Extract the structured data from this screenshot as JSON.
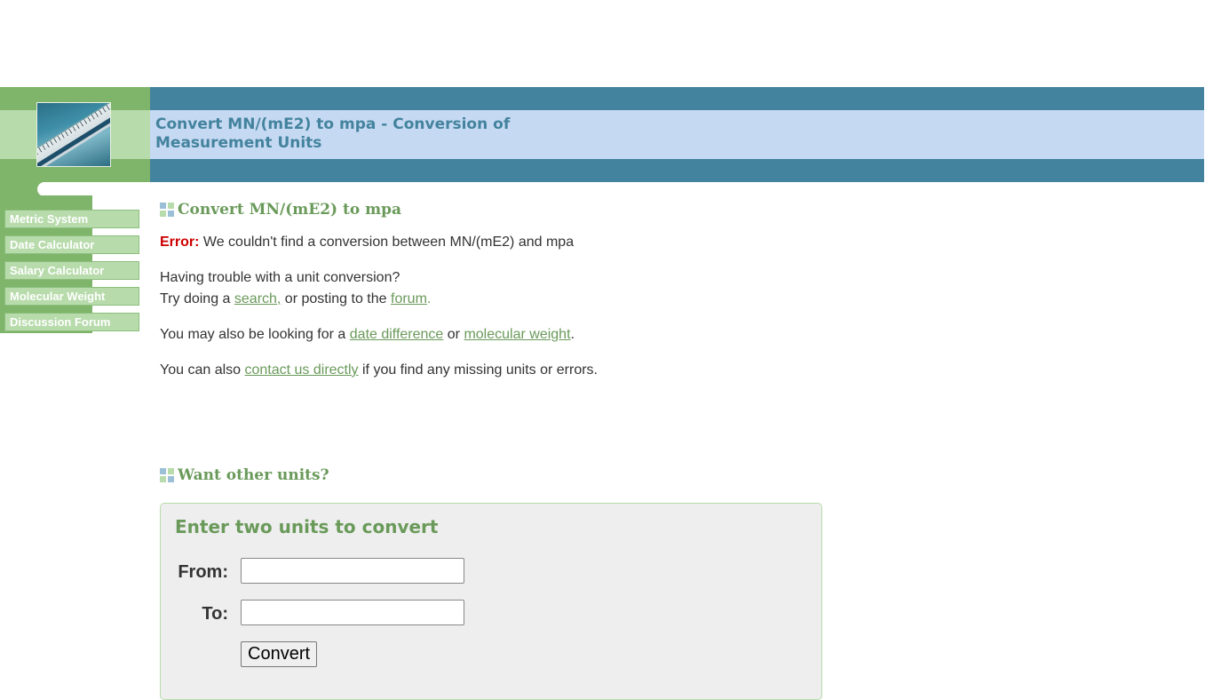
{
  "header": {
    "title_line1": "Convert MN/(mE2) to mpa - Conversion of",
    "title_line2": "Measurement Units",
    "logo_icon": "ruler-thermometer-logo"
  },
  "sidebar": {
    "items": [
      {
        "label": "Metric System"
      },
      {
        "label": "Date Calculator"
      },
      {
        "label": "Salary Calculator"
      },
      {
        "label": "Molecular Weight"
      },
      {
        "label": "Discussion Forum"
      }
    ]
  },
  "main": {
    "heading": "Convert MN/(mE2) to mpa",
    "error_label": "Error:",
    "error_text": " We couldn't find a conversion between MN/(mE2) and mpa",
    "trouble_line": "Having trouble with a unit conversion?",
    "try_prefix": "Try doing a ",
    "search_link": "search,",
    "try_mid": " or posting to the ",
    "forum_link": "forum",
    "try_suffix": ".",
    "also_prefix": "You may also be looking for a ",
    "date_link": "date difference",
    "also_mid": " or ",
    "molecular_link": "molecular weight",
    "also_suffix": ".",
    "contact_prefix": "You can also ",
    "contact_link": "contact us directly",
    "contact_suffix": " if you find any missing units or errors.",
    "other_heading": "Want other units?"
  },
  "form": {
    "title": "Enter two units to convert",
    "from_label": "From:",
    "to_label": "To:",
    "from_value": "",
    "to_value": "",
    "convert_label": "Convert"
  },
  "colors": {
    "header_teal": "#43839d",
    "title_band": "#c6d9f3",
    "sidebar_green": "#7fb46b",
    "accent_green": "#6a9a5a",
    "error_red": "#cc0000"
  }
}
